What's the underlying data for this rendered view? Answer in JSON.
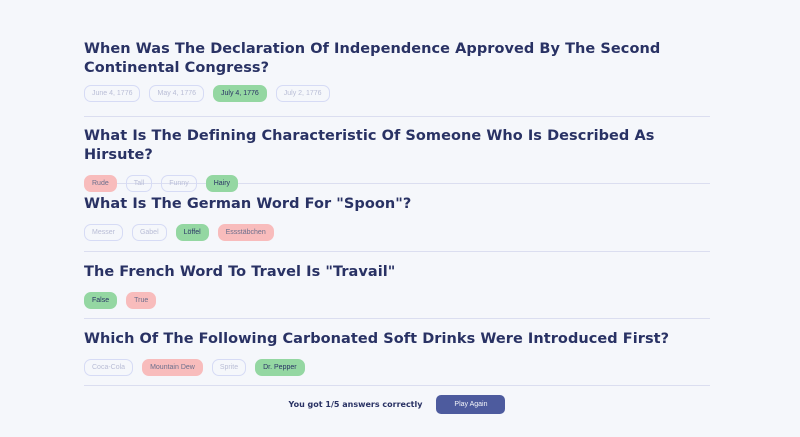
{
  "questions": [
    {
      "text": "When Was The Declaration Of Independence Approved By The Second Continental Congress?",
      "answers": [
        {
          "label": "June 4, 1776",
          "state": "neutral"
        },
        {
          "label": "May 4, 1776",
          "state": "neutral"
        },
        {
          "label": "July 4, 1776",
          "state": "correct"
        },
        {
          "label": "July 2, 1776",
          "state": "neutral"
        }
      ]
    },
    {
      "text": "What Is The Defining Characteristic Of Someone Who Is Described As Hirsute?",
      "answers": [
        {
          "label": "Rude",
          "state": "wrong"
        },
        {
          "label": "Tall",
          "state": "neutral"
        },
        {
          "label": "Funny",
          "state": "neutral"
        },
        {
          "label": "Hairy",
          "state": "correct"
        }
      ]
    },
    {
      "text": "What Is The German Word For \"Spoon\"?",
      "answers": [
        {
          "label": "Messer",
          "state": "neutral"
        },
        {
          "label": "Gabel",
          "state": "neutral"
        },
        {
          "label": "Löffel",
          "state": "correct"
        },
        {
          "label": "Essstäbchen",
          "state": "wrong"
        }
      ]
    },
    {
      "text": "The French Word To Travel Is \"Travail\"",
      "answers": [
        {
          "label": "False",
          "state": "correct"
        },
        {
          "label": "True",
          "state": "wrong"
        }
      ]
    },
    {
      "text": "Which Of The Following Carbonated Soft Drinks Were Introduced First?",
      "answers": [
        {
          "label": "Coca-Cola",
          "state": "neutral"
        },
        {
          "label": "Mountain Dew",
          "state": "wrong"
        },
        {
          "label": "Sprite",
          "state": "neutral"
        },
        {
          "label": "Dr. Pepper",
          "state": "correct"
        }
      ]
    }
  ],
  "footer": {
    "score_text": "You got 1/5 answers correctly",
    "play_again_label": "Play Again"
  },
  "colors": {
    "background": "#f5f7fb",
    "title": "#293264",
    "correct": "#94d7a2",
    "wrong": "#f8bcbc",
    "button": "#4d5b9e"
  }
}
